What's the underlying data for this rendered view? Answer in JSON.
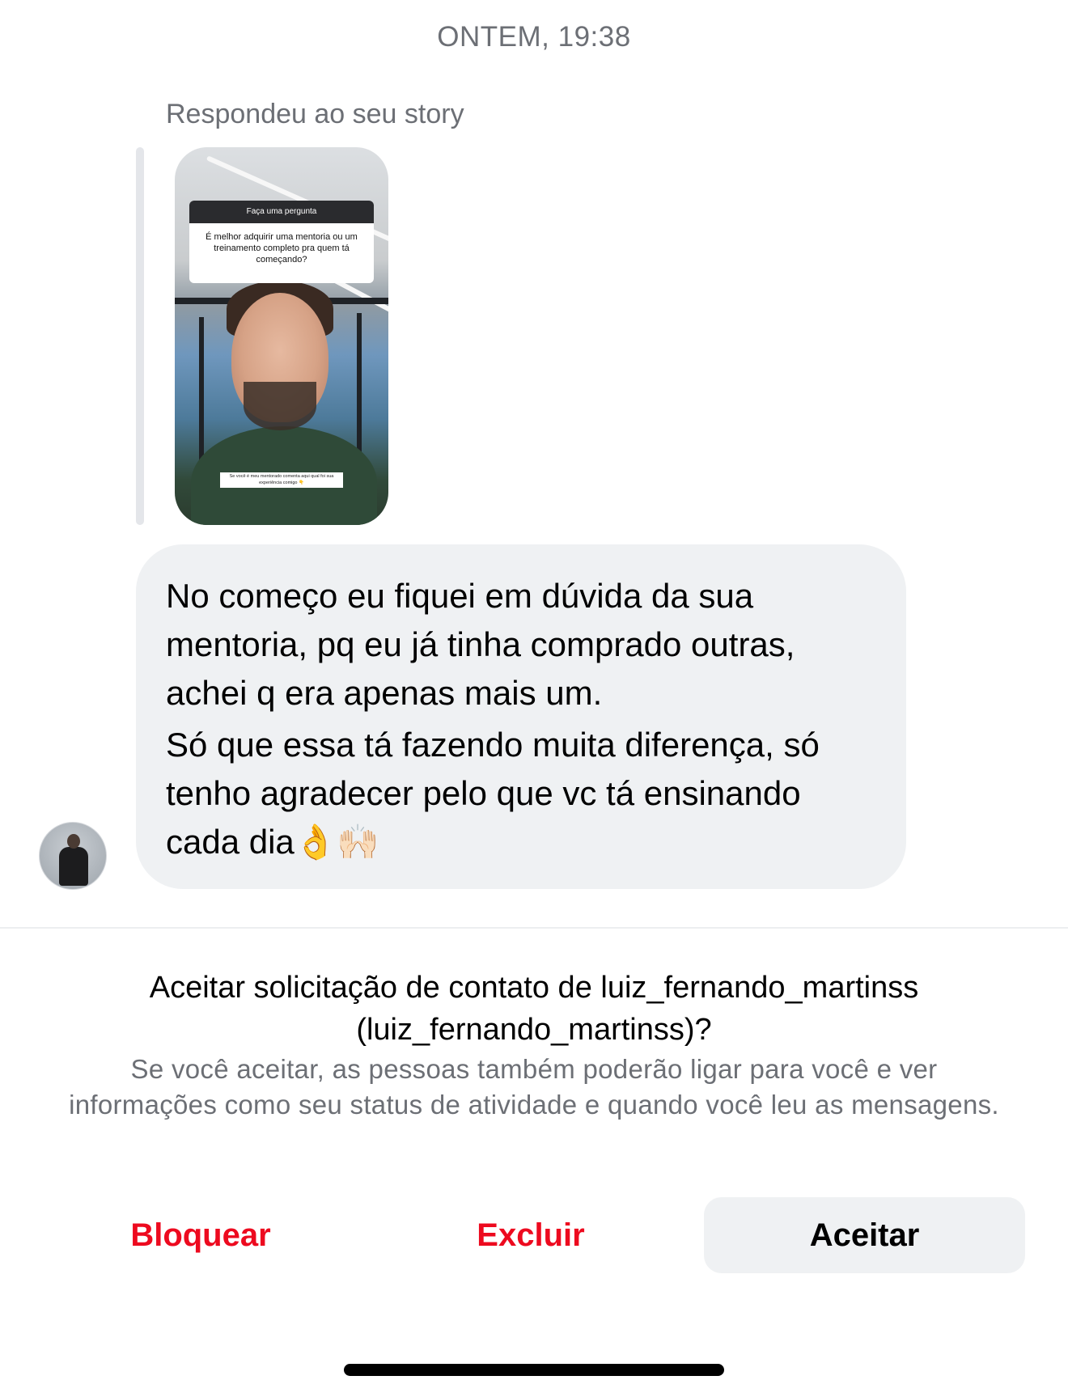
{
  "header": {
    "timestamp": "ONTEM, 19:38"
  },
  "conversation": {
    "reply_label": "Respondeu ao seu story",
    "story": {
      "question_header": "Faça uma pergunta",
      "question_text": "É melhor adquirir uma mentoria ou um treinamento completo pra quem tá começando?",
      "caption": "Se você é meu mentorado comenta aqui qual foi sua experiência comigo 👇"
    },
    "message": {
      "paragraph_1": "No começo eu fiquei em dúvida da sua mentoria, pq eu já tinha comprado outras, achei q era apenas mais um.",
      "paragraph_2": "Só que essa tá fazendo muita diferença, só tenho agradecer pelo que vc tá ensinando cada dia👌🙌🏻"
    },
    "sender_avatar_icon": "profile-photo"
  },
  "request": {
    "title": "Aceitar solicitação de contato de luiz_fernando_martinss (luiz_fernando_martinss)?",
    "description": "Se você aceitar, as pessoas também poderão ligar para você e ver informações como seu status de atividade e quando você leu as mensagens."
  },
  "actions": {
    "block_label": "Bloquear",
    "delete_label": "Excluir",
    "accept_label": "Aceitar"
  },
  "colors": {
    "danger": "#ed0a1f",
    "bubble_bg": "#eff1f3",
    "secondary_text": "#6c6f75"
  }
}
